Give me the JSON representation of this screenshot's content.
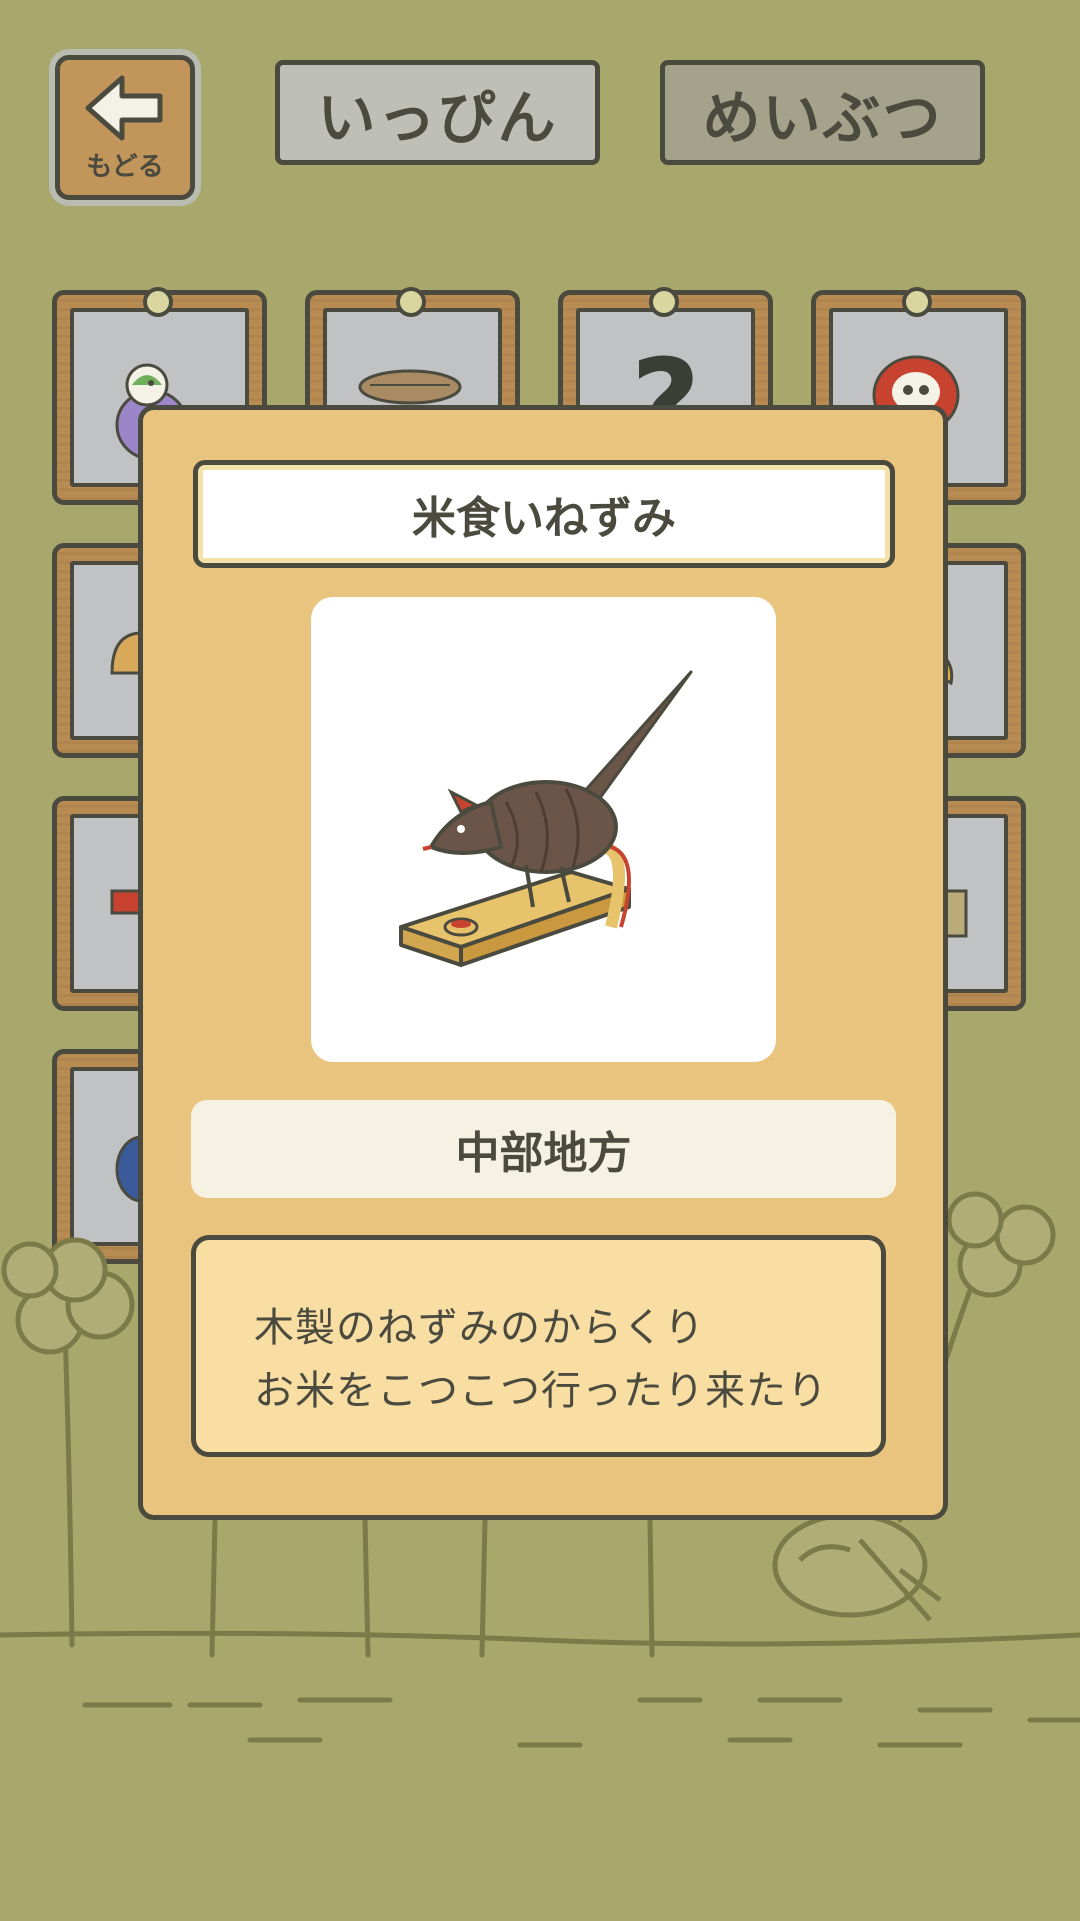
{
  "header": {
    "back_label": "もどる",
    "tabs": [
      {
        "label": "いっぴん",
        "selected": false
      },
      {
        "label": "めいぶつ",
        "selected": true
      }
    ]
  },
  "grid": {
    "slots": [
      {
        "item": "dove-figurine"
      },
      {
        "item": "straw-sandals"
      },
      {
        "item": "unknown",
        "label": "?"
      },
      {
        "item": "daruma-doll"
      },
      {
        "item": "comb"
      },
      {
        "item": "hidden"
      },
      {
        "item": "hidden"
      },
      {
        "item": "folding-fan"
      },
      {
        "item": "box"
      },
      {
        "item": "hidden"
      },
      {
        "item": "hidden"
      },
      {
        "item": "basket"
      },
      {
        "item": "plate"
      }
    ]
  },
  "detail": {
    "title": "米食いねずみ",
    "image_icon": "rice-eating-mouse-toy",
    "region": "中部地方",
    "description_lines": [
      "木製のねずみのからくり",
      "お米をこつこつ行ったり来たり"
    ]
  },
  "colors": {
    "background": "#a9a86c",
    "modal": "#e9c47e",
    "outline": "#4b4a3e"
  }
}
